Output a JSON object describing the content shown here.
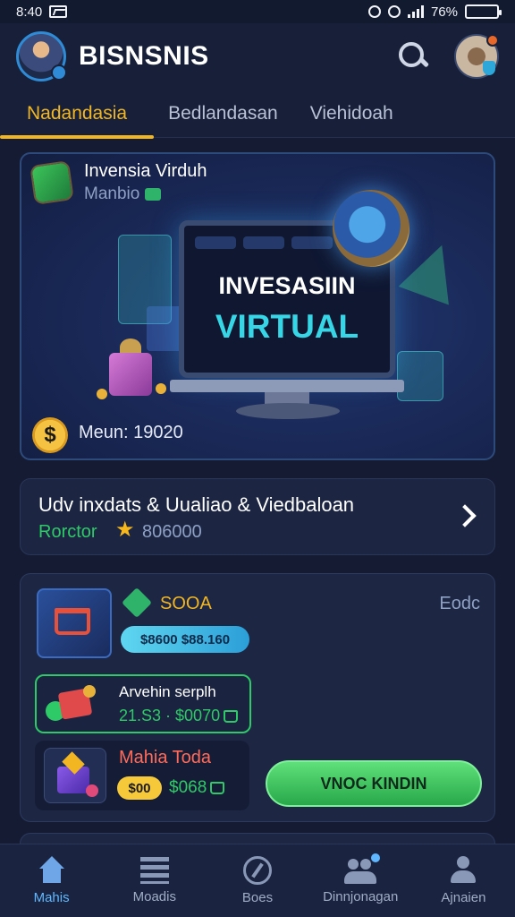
{
  "status_bar": {
    "time": "8:40",
    "battery": "76%"
  },
  "app": {
    "title": "BISNSNIS"
  },
  "tabs": [
    {
      "label": "Nadandasia",
      "active": true
    },
    {
      "label": "Bedlandasan",
      "active": false
    },
    {
      "label": "Viehidoah",
      "active": false
    }
  ],
  "hero": {
    "title": "Invensia Virduh",
    "subtitle": "Manbio",
    "screen_line1": "INVESASIIN",
    "screen_line2": "VIRTUAL",
    "minimum": "Meun: 19020"
  },
  "info": {
    "title": "Udv inxdats & Uualiao & Viedbaloan",
    "rating_label": "Rorctor",
    "rating_value": "806000"
  },
  "products": {
    "corner_label": "Eodc",
    "item1": {
      "title": "SOOA",
      "pill": "$8600  $88.160"
    },
    "item2": {
      "title": "Arvehin serplh",
      "values": "21.S3 · $0070"
    },
    "item3": {
      "title": "Mahia Toda",
      "pill": "$00",
      "price": "$068"
    },
    "cta_label": "VNOC KINDIN"
  },
  "bottom_nav": [
    {
      "label": "Mahis",
      "icon": "home-icon",
      "active": true
    },
    {
      "label": "Moadis",
      "icon": "list-icon",
      "active": false
    },
    {
      "label": "Boes",
      "icon": "compass-icon",
      "active": false
    },
    {
      "label": "Dinnjonagan",
      "icon": "users-icon",
      "active": false
    },
    {
      "label": "Ajnaien",
      "icon": "person-icon",
      "active": false
    }
  ],
  "colors": {
    "accent": "#f2b623",
    "positive": "#2fca68",
    "cyan": "#37d6e6",
    "background": "#141b33"
  }
}
